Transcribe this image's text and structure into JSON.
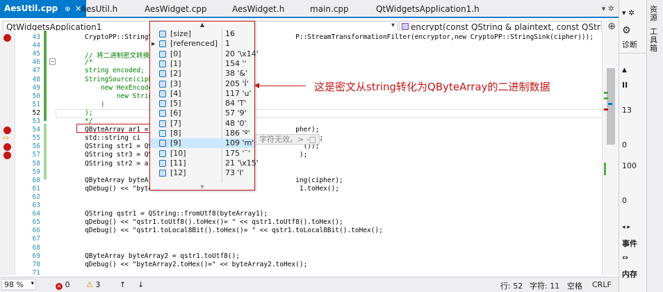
{
  "tabs": [
    {
      "label": "AesUtil.cpp",
      "active": true
    },
    {
      "label": "AesUtil.h",
      "active": false
    },
    {
      "label": "AesWidget.cpp",
      "active": false
    },
    {
      "label": "AesWidget.h",
      "active": false
    },
    {
      "label": "main.cpp",
      "active": false
    },
    {
      "label": "QtWidgetsApplication1.h",
      "active": false
    }
  ],
  "tab_pin": "⊕",
  "tab_close": "×",
  "tab_tools": "▾ ✲",
  "nav": {
    "project": "QtWidgetsApplication1",
    "member": "encrypt(const QString & plaintext, const QString",
    "split_icon": "⊕"
  },
  "code": {
    "line_numbers": [
      43,
      44,
      45,
      46,
      47,
      48,
      49,
      50,
      51,
      52,
      53,
      54,
      55,
      56,
      57,
      58,
      59,
      60,
      61,
      62,
      63,
      64,
      65,
      66,
      67,
      68,
      69,
      70,
      71
    ],
    "current_line": 52,
    "breakpoint_lines": [
      43,
      54,
      56,
      57
    ],
    "instruction_pointer_line": 55,
    "lines": [
      {
        "text": "CryptoPP::StringS                                    P::StreamTransformationFilter(encryptor,new CryptoPP::StringSink(cipher)));",
        "kind": "code"
      },
      {
        "text": "",
        "kind": "code"
      },
      {
        "text": "// 将二进制密文转换",
        "kind": "comment"
      },
      {
        "text": "/*",
        "kind": "comment"
      },
      {
        "text": "string encoded;",
        "kind": "comment"
      },
      {
        "text": "StringSource(ciph",
        "kind": "comment"
      },
      {
        "text": "    new HexEncode",
        "kind": "comment"
      },
      {
        "text": "        new Strin",
        "kind": "comment"
      },
      {
        "text": "    )",
        "kind": "comment"
      },
      {
        "text": ");",
        "kind": "comment"
      },
      {
        "text": "*/",
        "kind": "comment"
      },
      {
        "text": "QByteArray ar1 =                                     pher);",
        "kind": "code"
      },
      {
        "text": "std::string ci                                          ());",
        "kind": "code"
      },
      {
        "text": "QString str1 = QS                                      ());",
        "kind": "code"
      },
      {
        "text": "QString str3 = QS                                     );",
        "kind": "code"
      },
      {
        "text": "QString str2 = ar",
        "kind": "code"
      },
      {
        "text": "",
        "kind": "code"
      },
      {
        "text": "QByteArray byteAr                                    ing(cipher);",
        "kind": "code"
      },
      {
        "text": "qDebug() << \"byte                                     1.toHex();",
        "kind": "code"
      },
      {
        "text": "",
        "kind": "code"
      },
      {
        "text": "",
        "kind": "code"
      },
      {
        "text": "QString qstr1 = QString::fromUtf8(byteArray1);",
        "kind": "code"
      },
      {
        "text": "qDebug() << \"qstr1.toUtf8().toHex()= \" << qstr1.toUtf8().toHex();",
        "kind": "code"
      },
      {
        "text": "qDebug() << \"qstr1.toLocal8Bit().toHex()= \" << qstr1.toLocal8Bit().toHex();",
        "kind": "code"
      },
      {
        "text": "",
        "kind": "code"
      },
      {
        "text": "",
        "kind": "code"
      },
      {
        "text": "QByteArray byteArray2 = qstr1.toUtf8();",
        "kind": "code"
      },
      {
        "text": "qDebug() << \"byteArray2.toHex()=\" << byteArray2.toHex();",
        "kind": "code"
      },
      {
        "text": "",
        "kind": "code"
      }
    ]
  },
  "datatip": {
    "header": "▲",
    "footer": "▼",
    "rows": [
      {
        "name": "[size]",
        "value": "16",
        "expandable": false
      },
      {
        "name": "[referenced]",
        "value": "1",
        "expandable": true
      },
      {
        "name": "[0]",
        "value": "20 '\\x14'",
        "expandable": false
      },
      {
        "name": "[1]",
        "value": "154 ''",
        "expandable": false
      },
      {
        "name": "[2]",
        "value": "38 '&'",
        "expandable": false
      },
      {
        "name": "[3]",
        "value": "205 'Í'",
        "expandable": false
      },
      {
        "name": "[4]",
        "value": "117 'u'",
        "expandable": false
      },
      {
        "name": "[5]",
        "value": "84 'T'",
        "expandable": false
      },
      {
        "name": "[6]",
        "value": "57 '9'",
        "expandable": false
      },
      {
        "name": "[7]",
        "value": "48 '0'",
        "expandable": false
      },
      {
        "name": "[8]",
        "value": "186 'º'",
        "expandable": false
      },
      {
        "name": "[9]",
        "value": "109 'm'",
        "expandable": false
      },
      {
        "name": "[10]",
        "value": "175 '¯'",
        "expandable": false
      },
      {
        "name": "[11]",
        "value": "21 '\\x15'",
        "expandable": false
      },
      {
        "name": "[12]",
        "value": "73 'I'",
        "expandable": false
      }
    ],
    "selected_index": 11
  },
  "peek_text": "字符无效。> -□",
  "annotation": "这是密文从string转化为QByteArray的二进制数据",
  "status": {
    "zoom": "98 %",
    "errors": "0",
    "warnings": "3",
    "line": "行: 52",
    "char": "字符: 11",
    "space": "空格",
    "eol": "CRLF"
  },
  "right_panel": {
    "top": "▾ ✲",
    "gear": "⚙",
    "diag": "诊断",
    "collapse": "▲",
    "pause": "II",
    "v1": "13",
    "v2": "0",
    "v3": "100",
    "v4": "0",
    "events": "事件",
    "memory": "内存",
    "chevrons": "◂ ▸",
    "links": "⇔"
  },
  "side_tabs": [
    "资源",
    "工具箱"
  ],
  "colors": {
    "accent": "#007acc",
    "breakpoint": "#c51616",
    "annotation": "#c51616",
    "change_bar": "#57a64a"
  }
}
